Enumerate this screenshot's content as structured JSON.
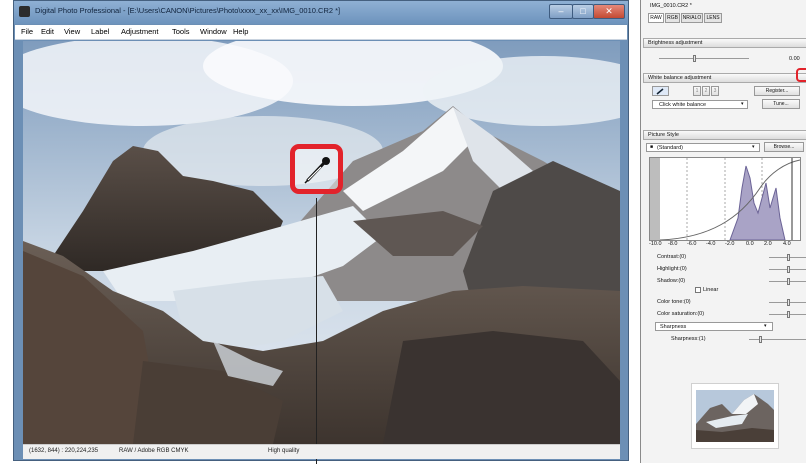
{
  "window": {
    "title": "Digital Photo Professional - [E:\\Users\\CANON\\Pictures\\Photo\\xxxx_xx_xx\\IMG_0010.CR2 *]",
    "controls": {
      "minimize": "–",
      "maximize": "□",
      "close": "✕"
    }
  },
  "menu": [
    "File",
    "Edit",
    "View",
    "Label",
    "Adjustment",
    "Tools",
    "Window",
    "Help"
  ],
  "status": {
    "coords": "(1632, 844) : 220,224,235",
    "color_space": "RAW / Adobe RGB  CMYK",
    "quality": "High quality"
  },
  "panel": {
    "title": "IMG_0010.CR2 *",
    "tabs": [
      "RAW",
      "RGB",
      "NR/ALO",
      "LENS"
    ],
    "brightness": {
      "label": "Brightness adjustment",
      "value": "0.00"
    },
    "white_balance": {
      "label": "White balance adjustment",
      "slots": [
        "1",
        "2",
        "3"
      ],
      "register": "Register...",
      "mode": "Click white balance",
      "tune": "Tune..."
    },
    "picture_style": {
      "label": "Picture Style",
      "value": "(Standard)",
      "browse": "Browse..."
    },
    "histogram_ticks": [
      "-10.0",
      "-8.0",
      "-6.0",
      "-4.0",
      "-2.0",
      "0.0",
      "2.0",
      "4.0"
    ],
    "params": {
      "contrast": "Contrast:(0)",
      "highlight": "Highlight:(0)",
      "shadow": "Shadow:(0)",
      "linear": "Linear",
      "color_tone": "Color tone:(0)",
      "color_saturation": "Color saturation:(0)",
      "sharpness_mode": "Sharpness",
      "sharpness": "Sharpness:(1)"
    },
    "colors": {
      "highlight_border": "#e2232b",
      "titlebar": "#6d93bd"
    }
  },
  "icons": {
    "eyedropper": "eyedropper-icon"
  }
}
